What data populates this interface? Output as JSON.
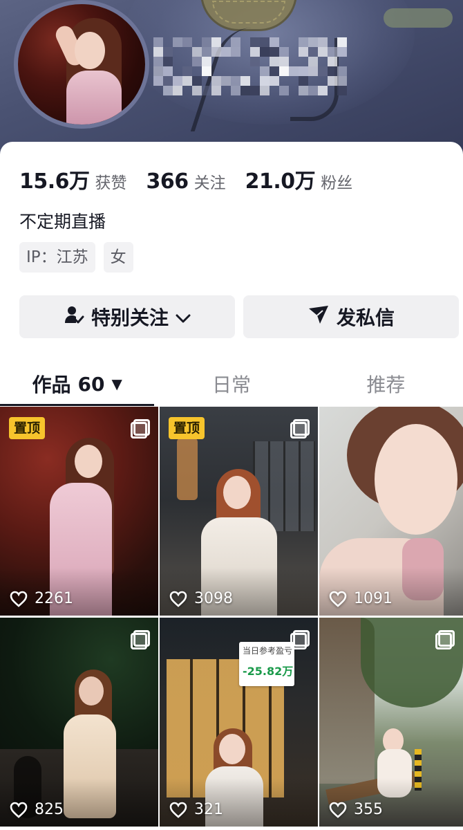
{
  "profile": {
    "stats": [
      {
        "value": "15.6万",
        "label": "获赞"
      },
      {
        "value": "366",
        "label": "关注"
      },
      {
        "value": "21.0万",
        "label": "粉丝"
      }
    ],
    "bio": "不定期直播",
    "tags": [
      {
        "text": "IP：江苏"
      },
      {
        "text": "女"
      }
    ]
  },
  "actions": {
    "follow_label": "特别关注",
    "message_label": "发私信"
  },
  "tabs": [
    {
      "label": "作品",
      "count": "60"
    },
    {
      "label": "日常"
    },
    {
      "label": "推荐"
    }
  ],
  "posts": [
    {
      "pinned": true,
      "pin_label": "置顶",
      "likes": "2261"
    },
    {
      "pinned": true,
      "pin_label": "置顶",
      "likes": "3098"
    },
    {
      "pinned": false,
      "likes": "1091"
    },
    {
      "pinned": false,
      "likes": "825"
    },
    {
      "pinned": false,
      "likes": "321",
      "overlay_label": "当日参考盈亏",
      "overlay_value": "-25.82万"
    },
    {
      "pinned": false,
      "likes": "355"
    }
  ],
  "colors": {
    "pin_badge": "#f7c42c",
    "overlay_value": "#1a9a4a",
    "header_bg": "#4a5272"
  }
}
